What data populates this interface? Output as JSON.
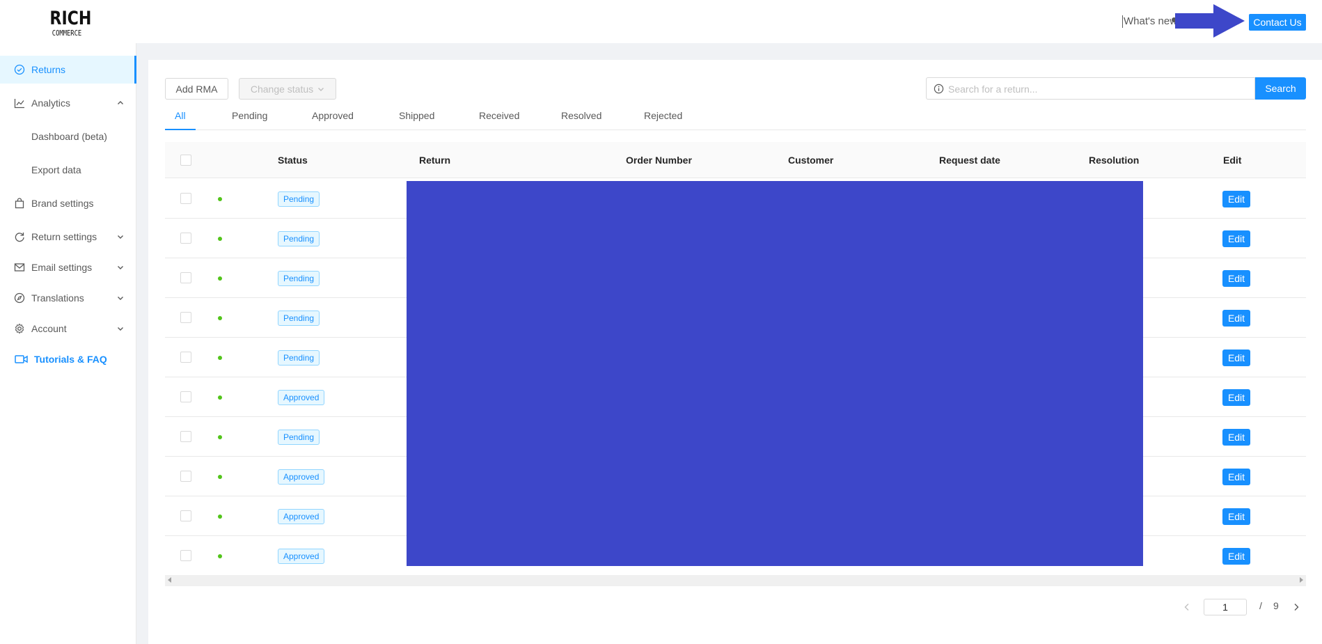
{
  "header": {
    "logo_line1": "RICH",
    "logo_line2": "COMMERCE",
    "whats_new": "What's new",
    "contact": "Contact Us"
  },
  "sidebar": {
    "items": [
      {
        "label": "Returns",
        "icon": "check-circle-icon"
      },
      {
        "label": "Analytics",
        "icon": "line-chart-icon"
      },
      {
        "label": "Dashboard (beta)"
      },
      {
        "label": "Export data"
      },
      {
        "label": "Brand settings",
        "icon": "shopping-bag-icon"
      },
      {
        "label": "Return settings",
        "icon": "redo-icon"
      },
      {
        "label": "Email settings",
        "icon": "mail-icon"
      },
      {
        "label": "Translations",
        "icon": "compass-icon"
      },
      {
        "label": "Account",
        "icon": "gear-icon"
      },
      {
        "label": "Tutorials & FAQ",
        "icon": "video-camera-icon"
      }
    ]
  },
  "toolbar": {
    "add_rma": "Add RMA",
    "change_status": "Change status",
    "search_placeholder": "Search for a return...",
    "search_button": "Search"
  },
  "tabs": [
    "All",
    "Pending",
    "Approved",
    "Shipped",
    "Received",
    "Resolved",
    "Rejected"
  ],
  "table": {
    "columns": [
      "Status",
      "Return",
      "Order Number",
      "Customer",
      "Request date",
      "Resolution",
      "Edit"
    ],
    "rows": [
      {
        "status": "Pending",
        "edit": "Edit"
      },
      {
        "status": "Pending",
        "edit": "Edit"
      },
      {
        "status": "Pending",
        "edit": "Edit"
      },
      {
        "status": "Pending",
        "edit": "Edit"
      },
      {
        "status": "Pending",
        "edit": "Edit"
      },
      {
        "status": "Approved",
        "edit": "Edit"
      },
      {
        "status": "Pending",
        "edit": "Edit"
      },
      {
        "status": "Approved",
        "edit": "Edit"
      },
      {
        "status": "Approved",
        "edit": "Edit"
      },
      {
        "status": "Approved",
        "edit": "Edit"
      }
    ]
  },
  "pagination": {
    "current": "1",
    "separator": "/",
    "total": "9"
  },
  "colors": {
    "accent": "#1890ff",
    "redaction": "#3d47c9",
    "status_dot": "#52c41a"
  }
}
